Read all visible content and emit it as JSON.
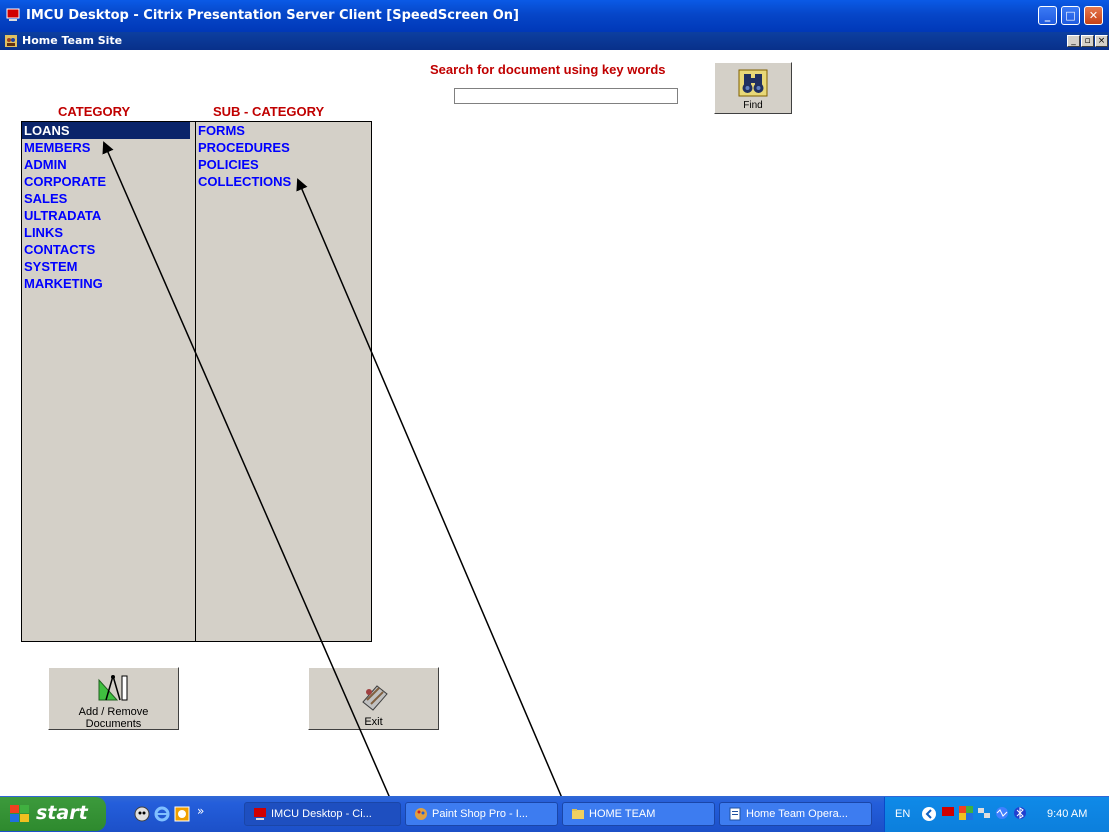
{
  "window": {
    "title": "IMCU Desktop - Citrix Presentation Server Client [SpeedScreen On]",
    "inner_title": "Home Team Site",
    "min_label": "_",
    "restore_label": "□",
    "close_label": "✕",
    "inner_min_label": "_",
    "inner_restore_label": "▫",
    "inner_close_label": "×"
  },
  "search": {
    "label": "Search for document using key words",
    "value": "",
    "find_label": "Find"
  },
  "category": {
    "header": "CATEGORY",
    "items": [
      "LOANS",
      "MEMBERS",
      "ADMIN",
      "CORPORATE",
      "SALES",
      "ULTRADATA",
      "LINKS",
      "CONTACTS",
      "SYSTEM",
      "MARKETING"
    ],
    "selected": "LOANS"
  },
  "subcategory": {
    "header": "SUB - CATEGORY",
    "items": [
      "FORMS",
      "PROCEDURES",
      "POLICIES",
      "COLLECTIONS"
    ]
  },
  "buttons": {
    "add_remove_line1": "Add / Remove",
    "add_remove_line2": "Documents",
    "exit": "Exit"
  },
  "taskbar": {
    "start": "start",
    "items": [
      "IMCU Desktop - Ci...",
      "Paint Shop Pro - I...",
      "HOME TEAM",
      "Home Team Opera..."
    ],
    "language": "EN",
    "clock": "9:40 AM",
    "chevron": "»"
  },
  "colors": {
    "header_red": "#c00000",
    "item_blue": "#0000ff",
    "selection": "#0a246a",
    "panel_gray": "#d4d0c8"
  }
}
